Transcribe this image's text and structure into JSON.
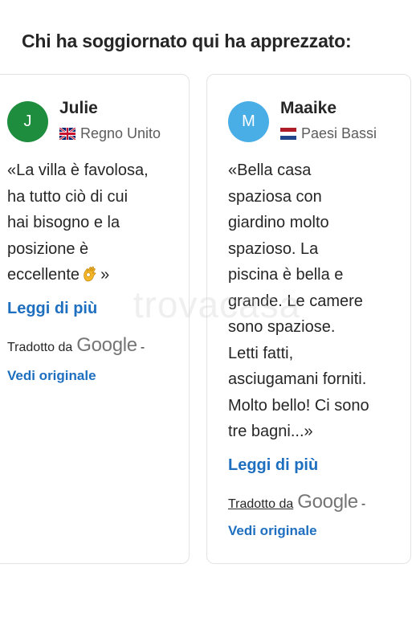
{
  "section": {
    "title": "Chi ha soggiornato qui ha apprezzato:"
  },
  "reviews": [
    {
      "avatar_letter": "J",
      "avatar_color": "#1e8e3e",
      "name": "Julie",
      "flag_icon": "uk-flag-icon",
      "country": "Regno Unito",
      "text_lines": [
        "«La villa è favolosa,",
        "ha tutto ciò di cui",
        "hai bisogno e la",
        "posizione è",
        "eccellente",
        "»"
      ],
      "emoji_icon": "ok-hand-emoji-icon",
      "read_more": "Leggi di più",
      "translated_by": "Tradotto da",
      "translator": "Google",
      "separator": "-",
      "view_original": "Vedi originale"
    },
    {
      "avatar_letter": "M",
      "avatar_color": "#4aaee6",
      "name": "Maaike",
      "flag_icon": "netherlands-flag-icon",
      "country": "Paesi Bassi",
      "text_lines": [
        "«Bella casa",
        "spaziosa con",
        "giardino molto",
        "spazioso. La",
        "piscina è bella e",
        "grande. Le camere",
        "sono spaziose.",
        "Letti fatti,",
        "asciugamani forniti.",
        "Molto bello! Ci sono",
        "tre bagni...»"
      ],
      "read_more": "Leggi di più",
      "translated_by": "Tradotto da",
      "translator": "Google",
      "separator": "-",
      "view_original": "Vedi originale"
    }
  ],
  "watermark": "trovacasa",
  "colors": {
    "link": "#1e6fbf",
    "text": "#262626",
    "muted": "#5c5c5c",
    "border": "#e3e3e3"
  }
}
